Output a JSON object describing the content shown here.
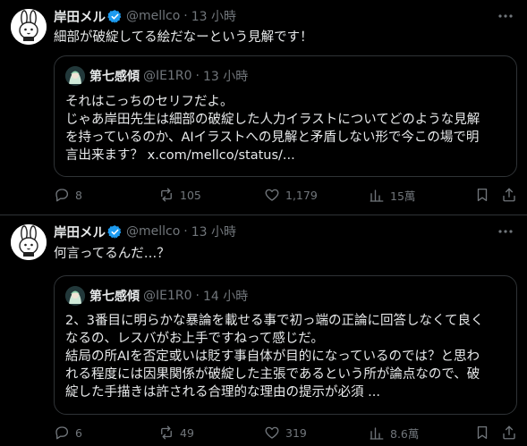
{
  "tweets": [
    {
      "author": "岸田メル",
      "handle": "@mellco",
      "separator": "·",
      "time": "13 小時",
      "text": "細部が破綻してる絵だなーという見解です！",
      "quote": {
        "author": "第七感傾",
        "handle": "@IE1R0",
        "separator": "·",
        "time": "13 小時",
        "lines": [
          "それはこっちのセリフだよ。",
          "じゃあ岸田先生は細部の破綻した人力イラストについてどのような見解",
          "を持っているのか、AIイラストへの見解と矛盾しない形で今この場で明",
          "言出来ます？ x.com/mellco/status/..."
        ]
      },
      "actions": {
        "replies": "8",
        "reposts": "105",
        "likes": "1,179",
        "views": "15萬"
      }
    },
    {
      "author": "岸田メル",
      "handle": "@mellco",
      "separator": "·",
      "time": "13 小時",
      "text": "何言ってるんだ…？",
      "quote": {
        "author": "第七感傾",
        "handle": "@IE1R0",
        "separator": "·",
        "time": "14 小時",
        "lines": [
          "2、3番目に明らかな暴論を載せる事で初っ端の正論に回答しなくて良く",
          "なるの、レスバがお上手ですねって感じだ。",
          "結局の所AIを否定或いは貶す事自体が目的になっているのでは？と思わ",
          "れる程度には因果関係が破綻した主張であるという所が論点なので、破",
          "綻した手描きは許される合理的な理由の提示が必須 ..."
        ]
      },
      "actions": {
        "replies": "6",
        "reposts": "49",
        "likes": "319",
        "views": "8.6萬"
      }
    }
  ],
  "icons": {
    "verified": "verified-badge-icon",
    "more": "more-dots-icon",
    "reply": "reply-icon",
    "repost": "repost-icon",
    "like": "heart-icon",
    "views": "views-chart-icon",
    "bookmark": "bookmark-icon",
    "share": "share-icon"
  },
  "colors": {
    "background": "#000000",
    "text": "#e7e9ea",
    "muted": "#71767b",
    "verified": "#1d9bf0",
    "border": "#2f3336"
  }
}
